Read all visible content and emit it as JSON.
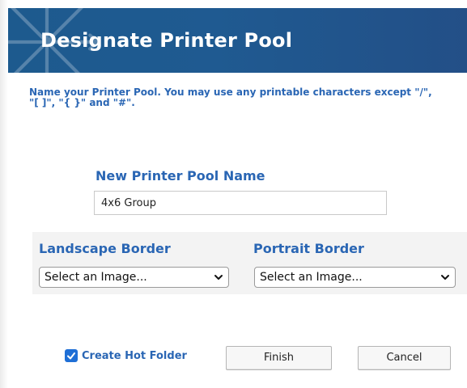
{
  "dialog": {
    "title": "Designate Printer Pool",
    "instructions": "Name your Printer Pool. You may use any printable characters except \"/\", \"[ ]\", \"{ }\" and \"#\".",
    "name_section": {
      "label": "New Printer Pool Name",
      "value": "4x6 Group",
      "placeholder": ""
    },
    "borders": {
      "landscape_label": "Landscape Border",
      "landscape_selected": "Select an Image...",
      "portrait_label": "Portrait Border",
      "portrait_selected": "Select an Image..."
    },
    "footer": {
      "hot_folder_label": "Create Hot Folder",
      "hot_folder_checked": true,
      "finish_label": "Finish",
      "cancel_label": "Cancel"
    }
  },
  "colors": {
    "header_blue": "#1f5a91",
    "label_blue": "#2a66b4",
    "checkbox_blue": "#1f6fd6"
  },
  "icons": {
    "header_decoration": "star-burst-icon",
    "select_arrow": "chevron-down-icon",
    "checkbox_mark": "checkmark-icon"
  }
}
